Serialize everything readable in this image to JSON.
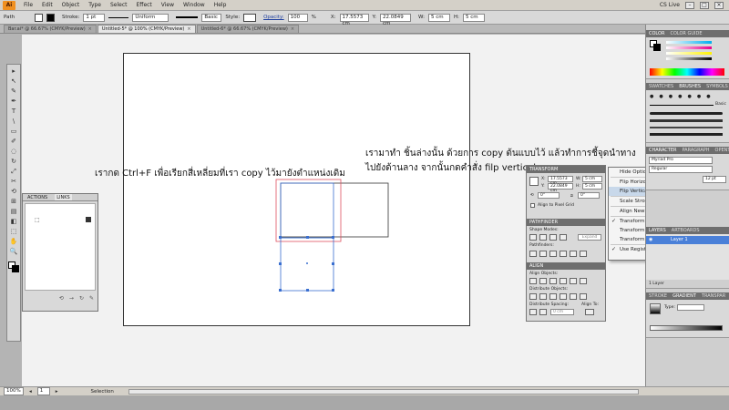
{
  "menubar": {
    "logo": "Ai",
    "menus": [
      "File",
      "Edit",
      "Object",
      "Type",
      "Select",
      "Effect",
      "View",
      "Window",
      "Help"
    ],
    "cslive": "CS Live"
  },
  "controlbar": {
    "object_label": "Path",
    "stroke_label": "Stroke:",
    "stroke_value": "1 pt",
    "profile_value": "Uniform",
    "brush_value": "Basic",
    "style_label": "Style:",
    "opacity_label": "Opacity:",
    "opacity_value": "100",
    "opacity_unit": "%",
    "x_label": "X:",
    "x_value": "17.5573 cm",
    "y_label": "Y:",
    "y_value": "22.0849 cm",
    "w_label": "W:",
    "w_value": "5 cm",
    "h_label": "H:",
    "h_value": "5 cm"
  },
  "tabs": [
    {
      "label": "Bar.ai* @ 66.67% (CMYK/Preview)"
    },
    {
      "label": "Untitled-5* @ 100% (CMYK/Preview)"
    },
    {
      "label": "Untitled-6* @ 66.67% (CMYK/Preview)"
    }
  ],
  "tools": [
    "▸",
    "↖",
    "✎",
    "✒",
    "T",
    "\\",
    "▭",
    "✐",
    "◌",
    "↻",
    "⤢",
    "✂",
    "⟲",
    "⊞",
    "▤",
    "◧",
    "⬚",
    "✋",
    "🔍"
  ],
  "annotations": {
    "left_note": "เรากด Ctrl+F เพื่อเรียกสี่เหลี่ยมที่เรา copy ไว้มายังตำแหน่งเดิม",
    "right_note_line1": "เรามาทำ ชิ้นล่างนั้น ด้วยการ copy ต้นแบบไว้ แล้วทำการชี้จุดนำทาง",
    "right_note_line2": "ไปยังด้านลาง จากนั้นกดคำสั่ง filp vertical"
  },
  "actions_panel": {
    "tabs": [
      "ACTIONS",
      "LINKS"
    ]
  },
  "transform_panel": {
    "title": "TRANSFORM",
    "x_label": "X:",
    "x_value": "17.5573 cm",
    "y_label": "Y:",
    "y_value": "22.0849 cm",
    "w_label": "W:",
    "w_value": "5 cm",
    "h_label": "H:",
    "h_value": "5 cm",
    "angle_value": "0°",
    "shear_value": "0°",
    "align_label": "Align to Pixel Grid"
  },
  "pathfinder_panel": {
    "title": "PATHFINDER",
    "shape_modes": "Shape Modes:",
    "expand": "Expand",
    "pathfinders": "Pathfinders:"
  },
  "align_panel": {
    "title": "ALIGN",
    "align_objects": "Align Objects:",
    "distribute_objects": "Distribute Objects:",
    "distribute_spacing": "Distribute Spacing:",
    "align_to": "Align To:",
    "spacing_value": "0 cm"
  },
  "flyout_menu": {
    "items": [
      {
        "label": "Hide Options",
        "checked": false,
        "highlight": false
      },
      {
        "label": "Flip Horizontal",
        "checked": false,
        "highlight": false
      },
      {
        "label": "Flip Vertical",
        "checked": false,
        "highlight": true
      },
      {
        "label": "Scale Strokes & Effects",
        "checked": false,
        "highlight": false
      },
      {
        "label": "Align New Objects to Pixel Grid",
        "checked": false,
        "highlight": false
      },
      {
        "label": "Transform Object Only",
        "checked": true,
        "highlight": false
      },
      {
        "label": "Transform Pattern Only",
        "checked": false,
        "highlight": false
      },
      {
        "label": "Transform Both",
        "checked": false,
        "highlight": false
      },
      {
        "label": "Use Registration Point for Symbol",
        "checked": true,
        "highlight": false
      }
    ]
  },
  "dock": {
    "color_tabs": [
      "COLOR",
      "COLOR GUIDE"
    ],
    "swatches_tabs": [
      "SWATCHES",
      "BRUSHES",
      "SYMBOLS"
    ],
    "brush_label": "Basic",
    "character_tabs": [
      "CHARACTER",
      "PARAGRAPH",
      "OPENTYPE"
    ],
    "font_value": "Myriad Pro",
    "font_style": "Regular",
    "font_size": "12 pt",
    "layers_tabs": [
      "LAYERS",
      "ARTBOARDS"
    ],
    "layer_name": "Layer 1",
    "layer_count": "1 Layer",
    "gradient_tabs": [
      "STROKE",
      "GRADIENT",
      "TRANSPAR"
    ],
    "gradient_type_label": "Type:"
  },
  "statusbar": {
    "zoom": "100%",
    "page": "1",
    "tool": "Selection"
  },
  "colors": {
    "selection_blue": "#3a6fd0",
    "guide_red": "#e05060",
    "panel_header": "#6e6e6e",
    "layer_highlight": "#4a80d8"
  }
}
